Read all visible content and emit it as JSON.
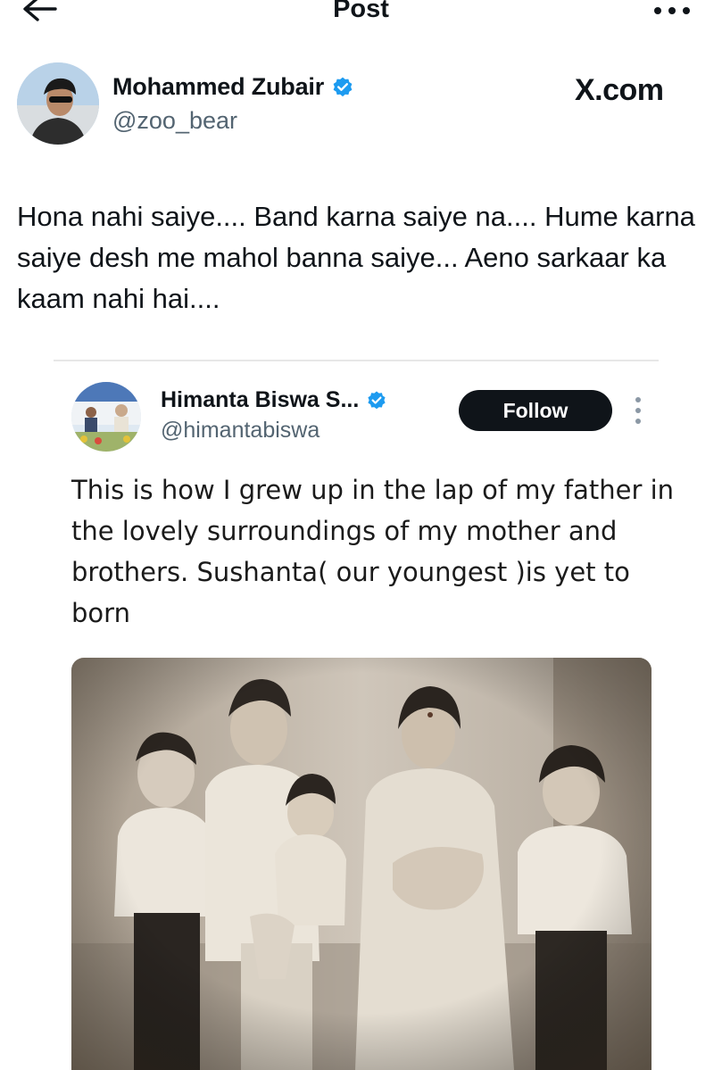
{
  "topbar": {
    "title": "Post",
    "back_icon": "arrow-left-icon",
    "more_icon": "more-horizontal-icon"
  },
  "post": {
    "author_name": "Mohammed Zubair",
    "author_handle": "@zoo_bear",
    "brand": "X.com",
    "text": "Hona nahi saiye.... Band karna saiye na.... Hume karna saiye desh me mahol banna saiye... Aeno sarkaar ka kaam nahi hai...."
  },
  "quoted": {
    "author_name": "Himanta Biswa S...",
    "author_handle": "@himantabiswa",
    "follow_label": "Follow",
    "text": "This is how I grew up in the lap of my father in the lovely surroundings of my mother and brothers. Sushanta( our youngest )is yet to born"
  },
  "colors": {
    "text": "#0f1419",
    "secondary": "#536471",
    "verified": "#1d9bf0",
    "follow_bg": "#0f1419"
  }
}
